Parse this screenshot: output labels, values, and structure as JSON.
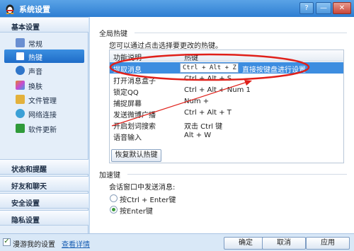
{
  "window": {
    "title": "系统设置",
    "help": "?",
    "minimize": "—",
    "close": "✕"
  },
  "sidebar": {
    "basic_header": "基本设置",
    "items": [
      {
        "label": "常规",
        "icon": "general-icon",
        "color": "#6a8fd1"
      },
      {
        "label": "热键",
        "icon": "hotkey-icon",
        "color": "#3b7bd6",
        "active": true
      },
      {
        "label": "声音",
        "icon": "sound-icon",
        "color": "#2f75c9"
      },
      {
        "label": "换肤",
        "icon": "skin-icon",
        "color": "#e0862b"
      },
      {
        "label": "文件管理",
        "icon": "folder-icon",
        "color": "#e3b13c"
      },
      {
        "label": "网络连接",
        "icon": "network-icon",
        "color": "#3ba0d6"
      },
      {
        "label": "软件更新",
        "icon": "update-icon",
        "color": "#2f9a3a"
      }
    ],
    "sections": [
      "状态和提醒",
      "好友和聊天",
      "安全设置",
      "隐私设置"
    ]
  },
  "main": {
    "global_group": "全局热键",
    "description": "您可以通过点击选择要更改的热键。",
    "table": {
      "col_function": "功能说明",
      "col_hotkey": "热键",
      "rows": [
        {
          "name": "提取消息",
          "key": "Ctrl + Alt + Z",
          "hint": "直接按键盘进行设置",
          "selected": true
        },
        {
          "name": "打开消息盒子",
          "key": "Ctrl + Alt + S"
        },
        {
          "name": "锁定QQ",
          "key": "Ctrl + Alt + Num 1"
        },
        {
          "name": "捕捉屏幕",
          "key": "Num +"
        },
        {
          "name": "发送微博广播",
          "key": "Ctrl + Alt + T"
        },
        {
          "name": "开启划词搜索",
          "key": "双击 Ctrl 键"
        },
        {
          "name": "语音输入",
          "key": "Alt + W"
        }
      ]
    },
    "restore_button": "恢复默认热键",
    "accel_group": "加速键",
    "accel_desc": "会话窗口中发送消息:",
    "options": [
      {
        "label": "按Ctrl + Enter键",
        "checked": false
      },
      {
        "label": "按Enter键",
        "checked": true
      }
    ]
  },
  "footer": {
    "roaming_label": "漫游我的设置",
    "details_link": "查看详情",
    "roaming_checked": true,
    "ok": "确定",
    "cancel": "取消",
    "apply": "应用"
  },
  "colors": {
    "accent": "#3d8de0",
    "annotation": "#e0201a"
  }
}
